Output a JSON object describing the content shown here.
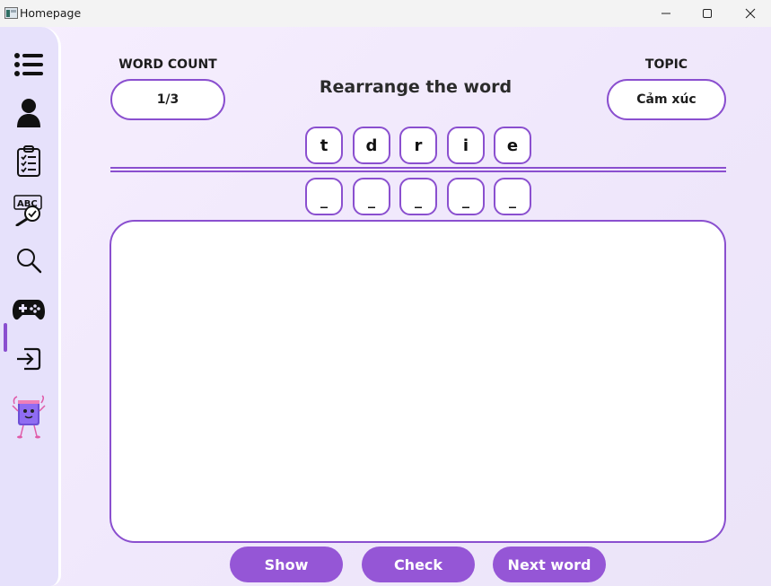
{
  "window": {
    "title": "Homepage"
  },
  "sidebar": {
    "items": [
      {
        "icon": "menu-list-icon"
      },
      {
        "icon": "user-icon"
      },
      {
        "icon": "clipboard-checklist-icon"
      },
      {
        "icon": "abc-magnifier-icon"
      },
      {
        "icon": "search-icon"
      },
      {
        "icon": "gamepad-icon",
        "active": true
      },
      {
        "icon": "logout-icon"
      },
      {
        "icon": "book-mascot-icon"
      }
    ]
  },
  "game": {
    "word_count_label": "WORD COUNT",
    "word_count_value": "1/3",
    "title": "Rearrange the word",
    "topic_label": "TOPIC",
    "topic_value": "Cảm xúc",
    "letters": [
      "t",
      "d",
      "r",
      "i",
      "e"
    ],
    "slots": [
      "_",
      "_",
      "_",
      "_",
      "_"
    ],
    "answer_text": ""
  },
  "buttons": {
    "show": "Show",
    "check": "Check",
    "next": "Next word"
  },
  "colors": {
    "accent": "#8a4fcf",
    "button": "#9556d6",
    "sidebar_bg": "#e6e1fb",
    "content_bg": "#f3eefb"
  }
}
